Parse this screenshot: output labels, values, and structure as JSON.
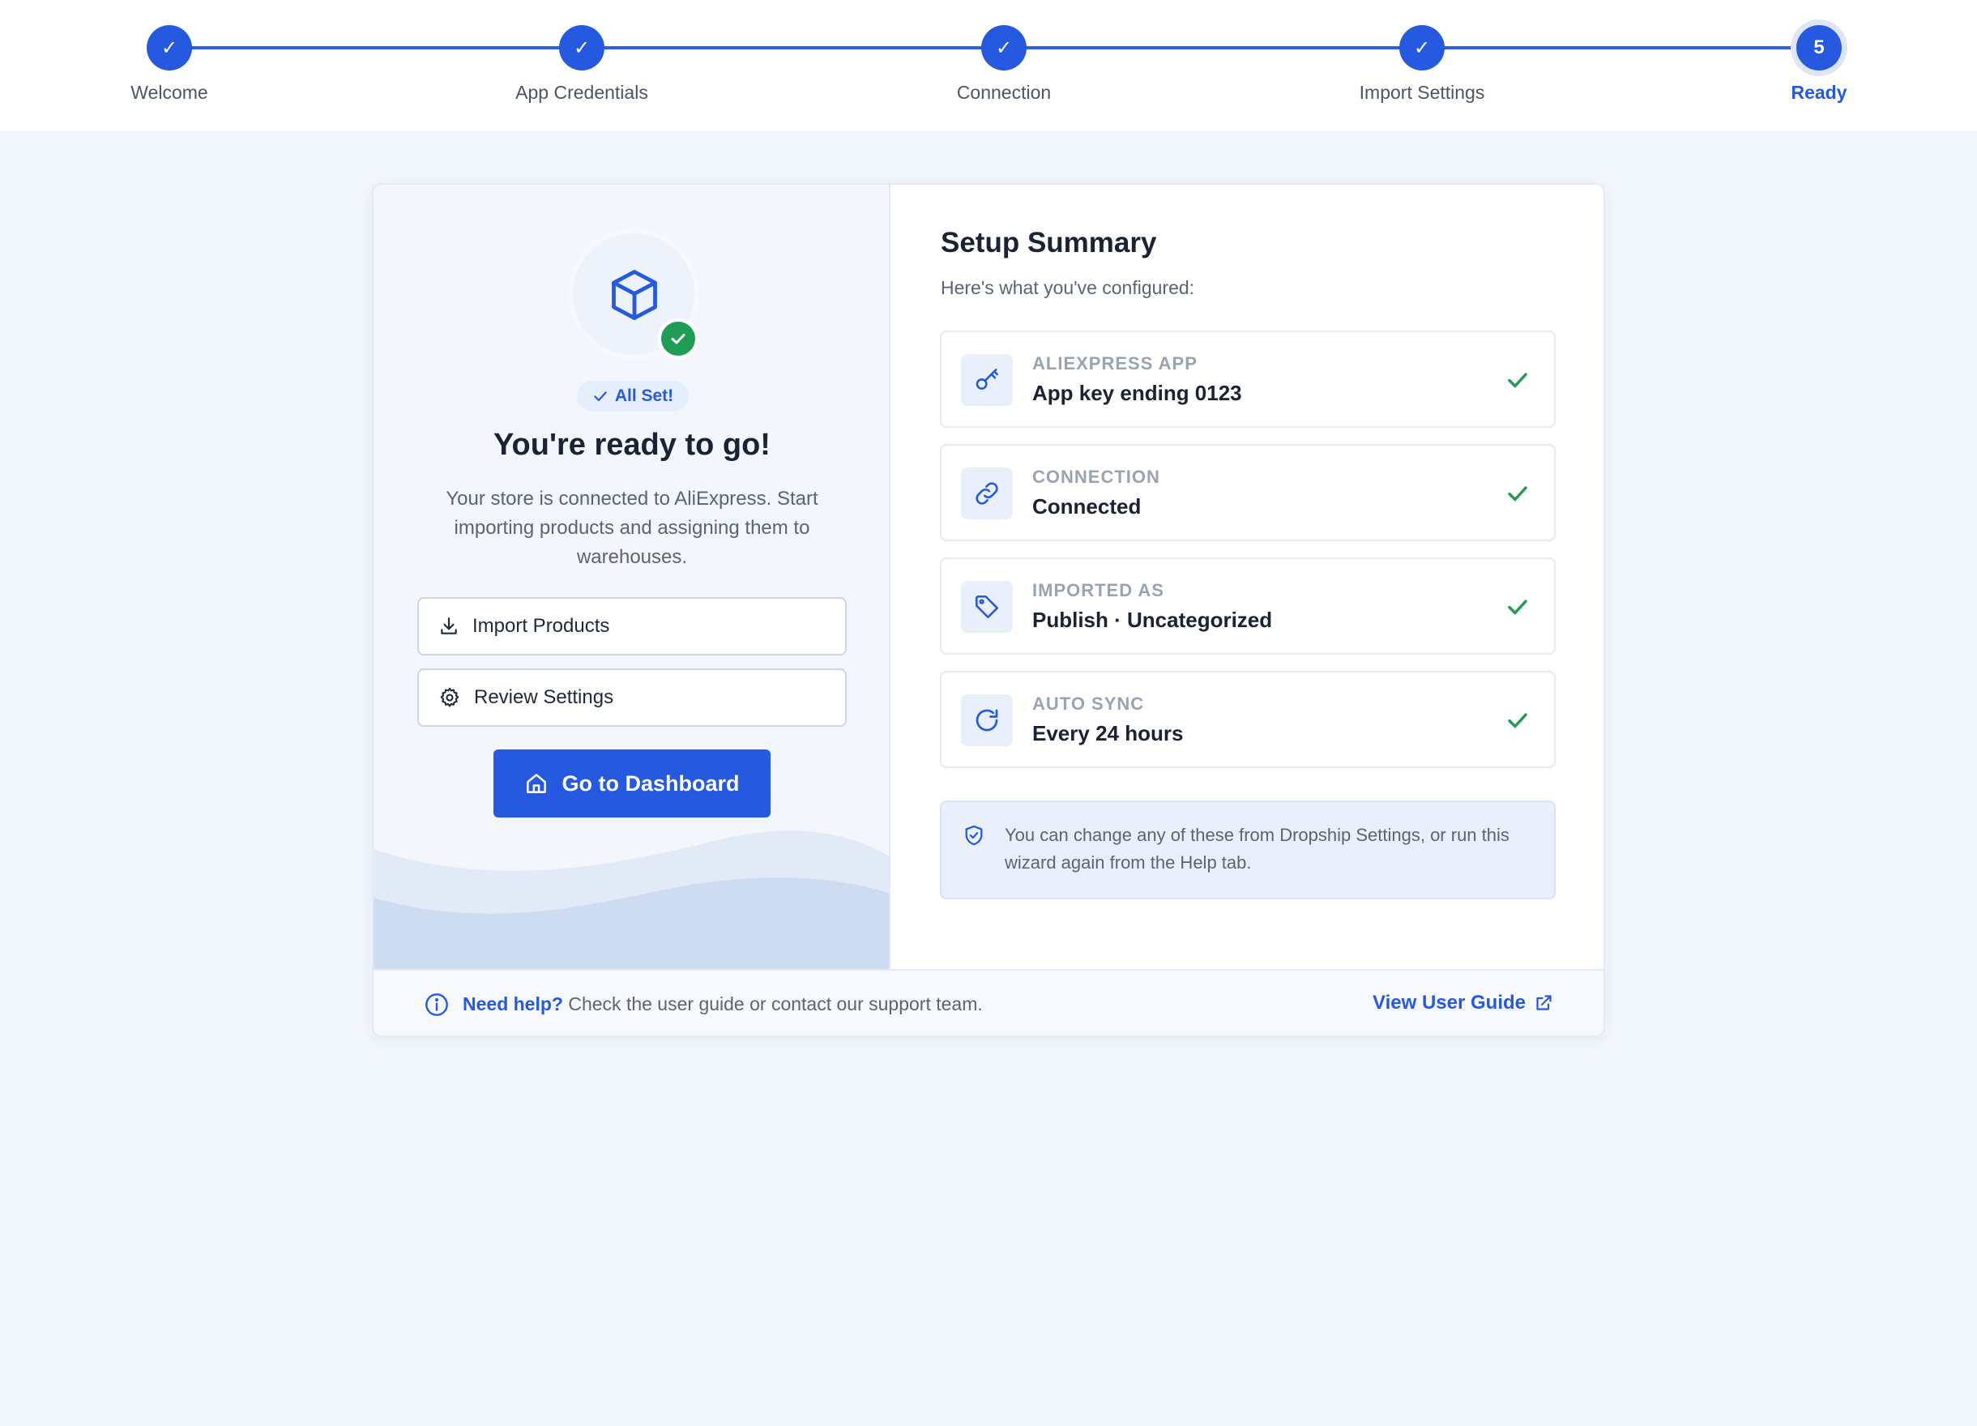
{
  "stepper": {
    "steps": [
      {
        "label": "Welcome",
        "marker": "✓"
      },
      {
        "label": "App Credentials",
        "marker": "✓"
      },
      {
        "label": "Connection",
        "marker": "✓"
      },
      {
        "label": "Import Settings",
        "marker": "✓"
      },
      {
        "label": "Ready",
        "marker": "5"
      }
    ],
    "current_step": 5
  },
  "hero": {
    "icon": "package-box-icon",
    "badge_icon": "check-circle-icon",
    "pill": "All Set!",
    "title": "You're ready to go!",
    "text": "Your store is connected to AliExpress. Start importing products and assigning them to warehouses."
  },
  "actions": {
    "import_label": "Import Products",
    "review_label": "Review Settings",
    "dashboard_label": "Go to Dashboard"
  },
  "summary": {
    "title": "Setup Summary",
    "subtitle": "Here's what you've configured:",
    "items": [
      {
        "key": "ALIEXPRESS APP",
        "value": "App key ending 0123",
        "icon": "key-icon"
      },
      {
        "key": "CONNECTION",
        "value": "Connected",
        "icon": "link-icon"
      },
      {
        "key": "IMPORTED AS",
        "value": "Publish · Uncategorized",
        "icon": "tag-icon"
      },
      {
        "key": "AUTO SYNC",
        "value": "Every 24 hours",
        "icon": "refresh-icon"
      }
    ],
    "note": "You can change any of these from Dropship Settings, or run this wizard again from the Help tab."
  },
  "footer": {
    "help_strong": "Need help?",
    "help_text": " Check the user guide or contact our support team.",
    "guide_link": "View User Guide"
  },
  "colors": {
    "accent": "#2459e0",
    "success": "#1f9d55",
    "background": "#f2f6fd"
  }
}
